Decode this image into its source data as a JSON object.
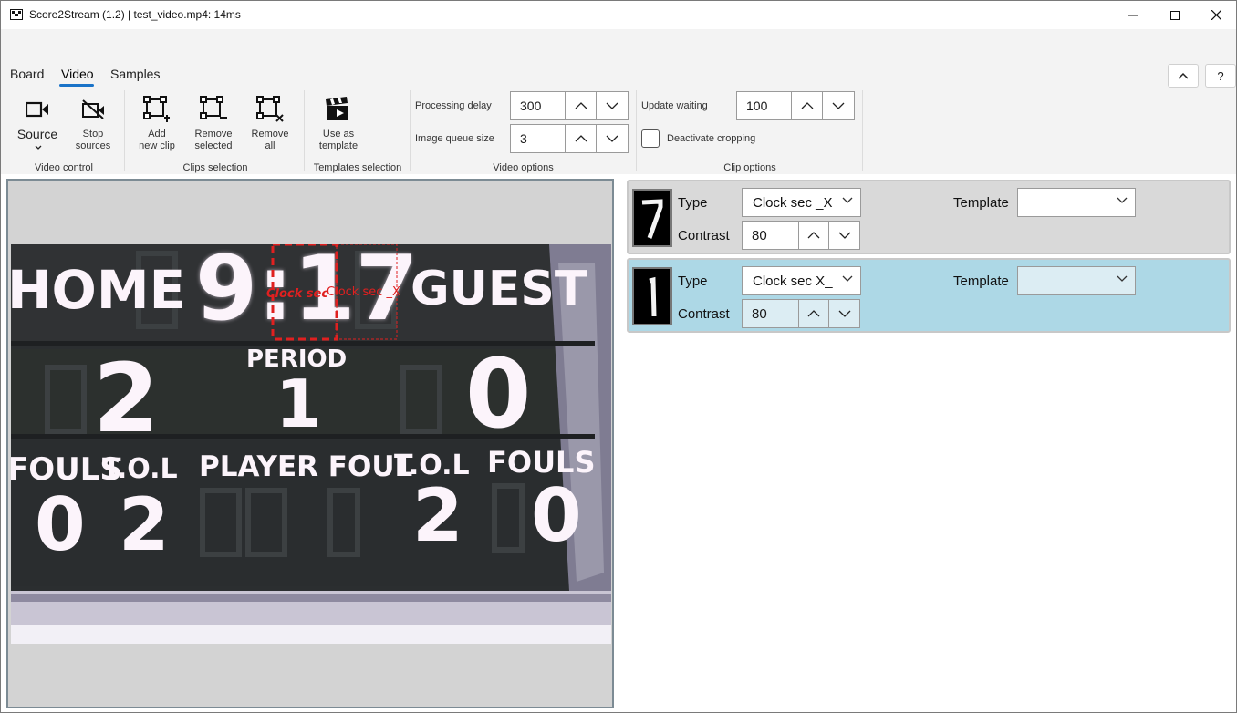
{
  "window": {
    "title": "Score2Stream (1.2) | test_video.mp4: 14ms"
  },
  "tabs": [
    {
      "label": "Board"
    },
    {
      "label": "Video"
    },
    {
      "label": "Samples"
    }
  ],
  "active_tab": "Video",
  "ribbon_top_buttons": {
    "collapse_icon": "chevron-up-icon",
    "help": "?"
  },
  "video_control": {
    "label": "Video control",
    "source": {
      "label": "Source",
      "icon": "video-camera-icon"
    },
    "stop": {
      "line1": "Stop",
      "line2": "sources",
      "icon": "video-off-icon"
    }
  },
  "clips_selection": {
    "label": "Clips selection",
    "add": {
      "line1": "Add",
      "line2": "new clip"
    },
    "remove_selected": {
      "line1": "Remove",
      "line2": "selected"
    },
    "remove_all": {
      "line1": "Remove",
      "line2": "all"
    }
  },
  "templates_selection": {
    "label": "Templates selection",
    "use": {
      "line1": "Use as",
      "line2": "template",
      "icon": "clapperboard-icon"
    }
  },
  "video_options": {
    "label": "Video options",
    "processing_delay": {
      "label": "Processing delay",
      "value": "300"
    },
    "image_queue_size": {
      "label": "Image queue size",
      "value": "3"
    }
  },
  "clip_options": {
    "label": "Clip options",
    "update_waiting": {
      "label": "Update waiting",
      "value": "100"
    },
    "deactivate_cropping": {
      "label": "Deactivate cropping",
      "checked": false
    }
  },
  "video": {
    "scoreboard": {
      "home": "HOME",
      "guest": "GUEST",
      "clock": "9:17",
      "period_label": "PERIOD",
      "period": "1",
      "home_score": "2",
      "guest_score": "0",
      "fouls_left": "FOULS",
      "tol_left": "T.O.L",
      "player_foul": "PLAYER FOUL",
      "tol_right": "T.O.L",
      "fouls_right": "FOULS",
      "home_fouls": "0",
      "home_tol": "2",
      "guest_tol": "2",
      "guest_fouls": "0"
    },
    "overlays": [
      {
        "label": "Clock sec",
        "selected": true
      },
      {
        "label": "Clock sec _X",
        "selected": false
      }
    ]
  },
  "clips": [
    {
      "thumb_digit": "7",
      "type_label": "Type",
      "type_value": "Clock sec _X",
      "contrast_label": "Contrast",
      "contrast_value": "80",
      "template_label": "Template",
      "template_value": "",
      "selected": false,
      "bg": "#d9d9d9"
    },
    {
      "thumb_digit": "1",
      "type_label": "Type",
      "type_value": "Clock sec X_",
      "contrast_label": "Contrast",
      "contrast_value": "80",
      "template_label": "Template",
      "template_value": "",
      "selected": true,
      "bg": "#add8e6"
    }
  ],
  "colors": {
    "accent": "#1a73c8",
    "selected_clip": "#add8e6",
    "overlay_red": "#e02020"
  }
}
